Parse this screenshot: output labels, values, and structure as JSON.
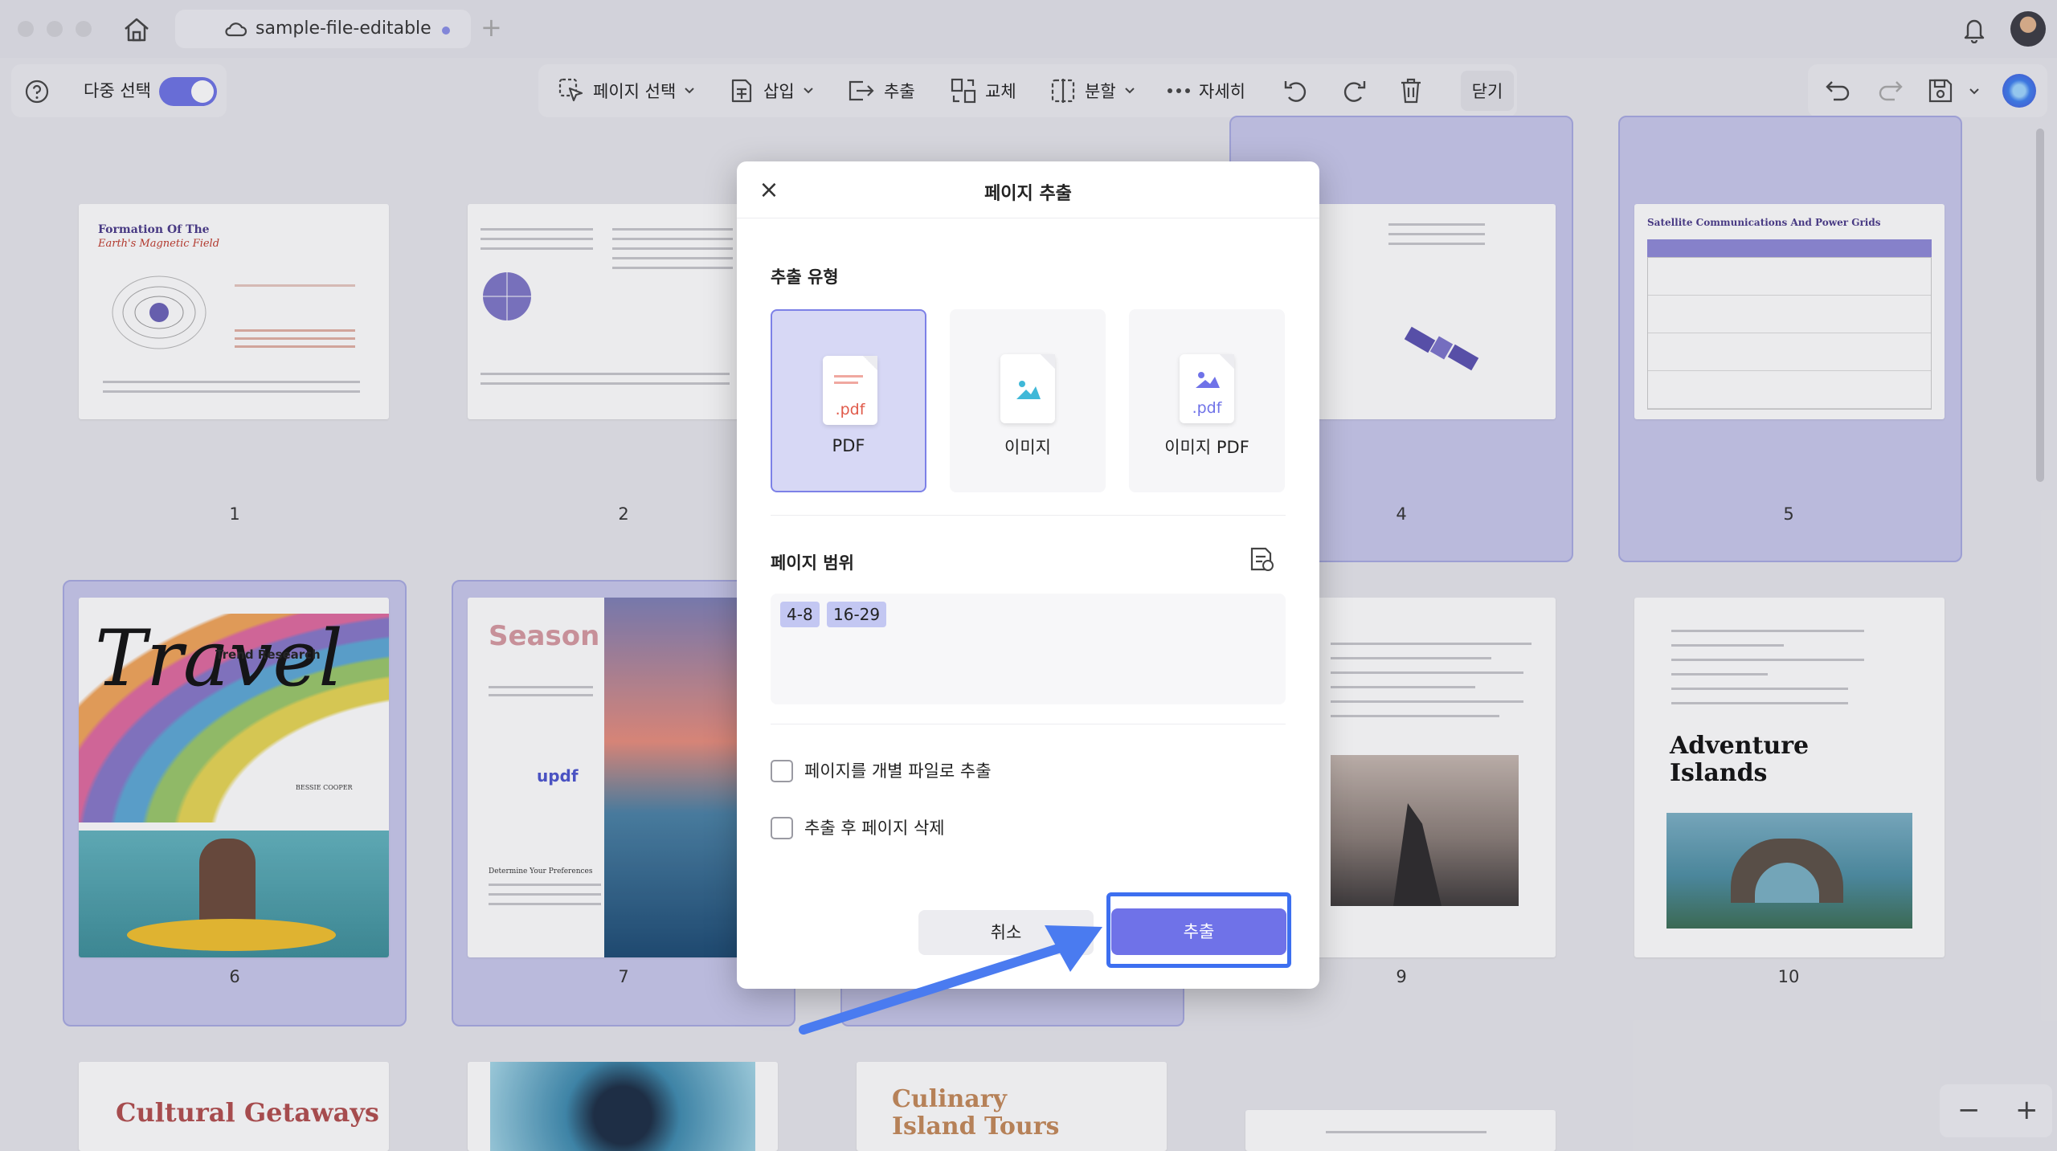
{
  "titlebar": {
    "tab_title": "sample-file-editable",
    "new_tab": "+"
  },
  "toolbar": {
    "multi_select_label": "다중 선택",
    "multi_select_on": true,
    "page_select": "페이지 선택",
    "insert": "삽입",
    "extract": "추출",
    "replace": "교체",
    "split": "분할",
    "more": "자세히",
    "close": "닫기"
  },
  "pages": [
    {
      "number": "1",
      "title": "Formation Of The",
      "subtitle": "Earth's Magnetic Field",
      "selected": false
    },
    {
      "number": "2",
      "selected": false
    },
    {
      "number": "4",
      "selected": true
    },
    {
      "number": "5",
      "title": "Satellite Communications And Power Grids",
      "selected": true
    },
    {
      "number": "6",
      "title": "Travel",
      "subtitle": "Trend Research",
      "author": "BESSIE COOPER",
      "selected": true
    },
    {
      "number": "7",
      "title": "Season",
      "brand": "updf",
      "section": "Determine Your Preferences",
      "selected": true
    },
    {
      "number": "9",
      "selected": false
    },
    {
      "number": "10",
      "title": "Adventure Islands",
      "selected": false
    },
    {
      "title": "Cultural Getaways"
    },
    {
      "title": "Culinary Island Tours"
    }
  ],
  "dialog": {
    "title": "페이지 추출",
    "type_label": "추출 유형",
    "types": [
      {
        "label": "PDF",
        "ext": ".pdf",
        "active": true
      },
      {
        "label": "이미지",
        "ext": "",
        "active": false
      },
      {
        "label": "이미지 PDF",
        "ext": ".pdf",
        "active": false
      }
    ],
    "range_label": "페이지 범위",
    "ranges": [
      "4-8",
      "16-29"
    ],
    "option_separate": "페이지를 개별 파일로 추출",
    "option_delete": "추출 후 페이지 삭제",
    "cancel": "취소",
    "extract": "추출"
  },
  "zoom": {
    "minus": "−",
    "plus": "+"
  },
  "colors": {
    "accent": "#6f72e8",
    "highlight": "#3d6ff0",
    "selected_page_bg": "#c9c9ec"
  }
}
